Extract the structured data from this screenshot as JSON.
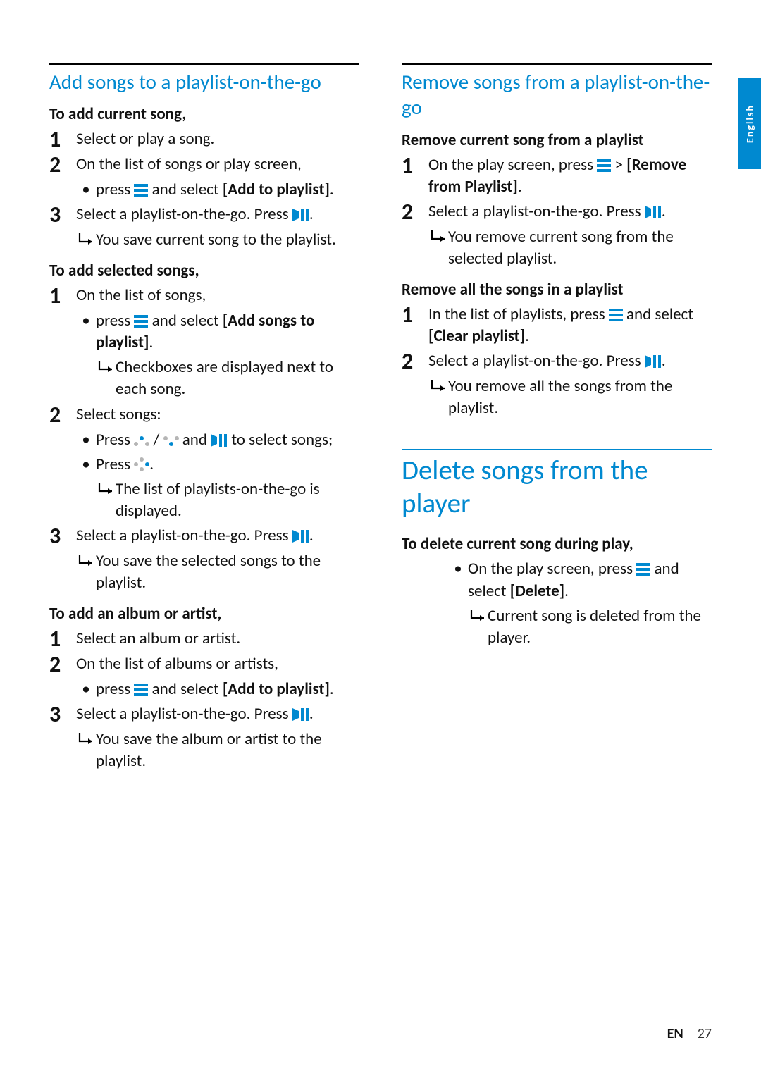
{
  "left": {
    "h3": "Add songs to a playlist-on-the-go",
    "sec1": {
      "sub": "To add current song,",
      "s1": "Select or play a song.",
      "s2": "On the list of songs or play screen,",
      "s2b1a": "press ",
      "s2b1b": " and select ",
      "s2b1opt": "[Add to playlist]",
      "s2b1c": ".",
      "s3a": "Select a playlist-on-the-go. Press ",
      "s3b": ".",
      "s3r": "You save current song to the playlist."
    },
    "sec2": {
      "sub": "To add selected songs,",
      "s1": "On the list of songs,",
      "s1b1a": "press ",
      "s1b1b": " and select ",
      "s1b1opt": "[Add songs to playlist]",
      "s1b1c": ".",
      "s1r": "Checkboxes are displayed next to each song.",
      "s2": "Select songs:",
      "s2b1a": "Press ",
      "s2b1b": " / ",
      "s2b1c": " and ",
      "s2b1d": " to select songs;",
      "s2b2a": "Press ",
      "s2b2b": ".",
      "s2r": "The list of playlists-on-the-go is displayed.",
      "s3a": "Select a playlist-on-the-go. Press ",
      "s3b": ".",
      "s3r": "You save the selected songs to the playlist."
    },
    "sec3": {
      "sub": "To add an album or artist,",
      "s1": "Select an album or artist.",
      "s2": "On the list of albums or artists,",
      "s2b1a": "press ",
      "s2b1b": " and select ",
      "s2b1opt": "[Add to playlist]",
      "s2b1c": ".",
      "s3a": "Select a playlist-on-the-go. Press ",
      "s3b": ".",
      "s3r": "You save the album or artist to the playlist."
    }
  },
  "right": {
    "h3": "Remove songs from a playlist-on-the-go",
    "sec1": {
      "sub": "Remove current song from a playlist",
      "s1a": "On the play screen, press ",
      "s1b": " > ",
      "s1opt": "[Remove from Playlist]",
      "s1c": ".",
      "s2a": "Select a playlist-on-the-go. Press ",
      "s2b": ".",
      "s2r": "You remove current song from the selected playlist."
    },
    "sec2": {
      "sub": "Remove all the songs in a playlist",
      "s1a": "In the list of playlists, press ",
      "s1b": " and select ",
      "s1opt": "[Clear playlist]",
      "s1c": ".",
      "s2a": "Select a playlist-on-the-go. Press ",
      "s2b": ".",
      "s2r": "You remove all the songs from the playlist."
    },
    "h2": "Delete songs from the player",
    "sec3": {
      "sub": "To delete current song during play,",
      "b1a": "On the play screen, press ",
      "b1b": " and select ",
      "b1opt": "[Delete]",
      "b1c": ".",
      "r": "Current song is deleted from the player."
    }
  },
  "labels": {
    "lang_tab": "English",
    "footer_lang": "EN",
    "footer_page": "27"
  }
}
